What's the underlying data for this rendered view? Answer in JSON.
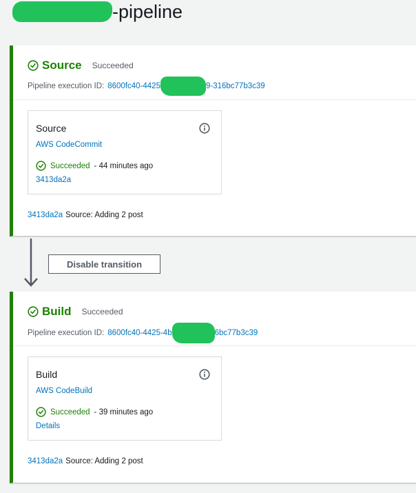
{
  "page": {
    "title_suffix": "-pipeline"
  },
  "colors": {
    "success": "#1d8102",
    "link": "#0073bb",
    "redaction": "#21c25a"
  },
  "stages": {
    "source": {
      "name": "Source",
      "status": "Succeeded",
      "execution_label": "Pipeline execution ID:",
      "execution_id_start": "8600fc40-4425",
      "execution_id_end": "9-316bc77b3c39",
      "action": {
        "name": "Source",
        "provider": "AWS CodeCommit",
        "status": "Succeeded",
        "time": "- 44 minutes ago",
        "link": "3413da2a"
      },
      "footer": {
        "commit": "3413da2a",
        "message": "Source: Adding 2 post"
      }
    },
    "build": {
      "name": "Build",
      "status": "Succeeded",
      "execution_label": "Pipeline execution ID:",
      "execution_id_start": "8600fc40-4425-4b",
      "execution_id_end": "6bc77b3c39",
      "action": {
        "name": "Build",
        "provider": "AWS CodeBuild",
        "status": "Succeeded",
        "time": "- 39 minutes ago",
        "link": "Details"
      },
      "footer": {
        "commit": "3413da2a",
        "message": "Source: Adding 2 post"
      }
    }
  },
  "transition": {
    "button_label": "Disable transition"
  },
  "icons": {
    "stage_status": "check-circle-icon",
    "action_info": "info-icon",
    "transition": "arrow-down-icon"
  }
}
